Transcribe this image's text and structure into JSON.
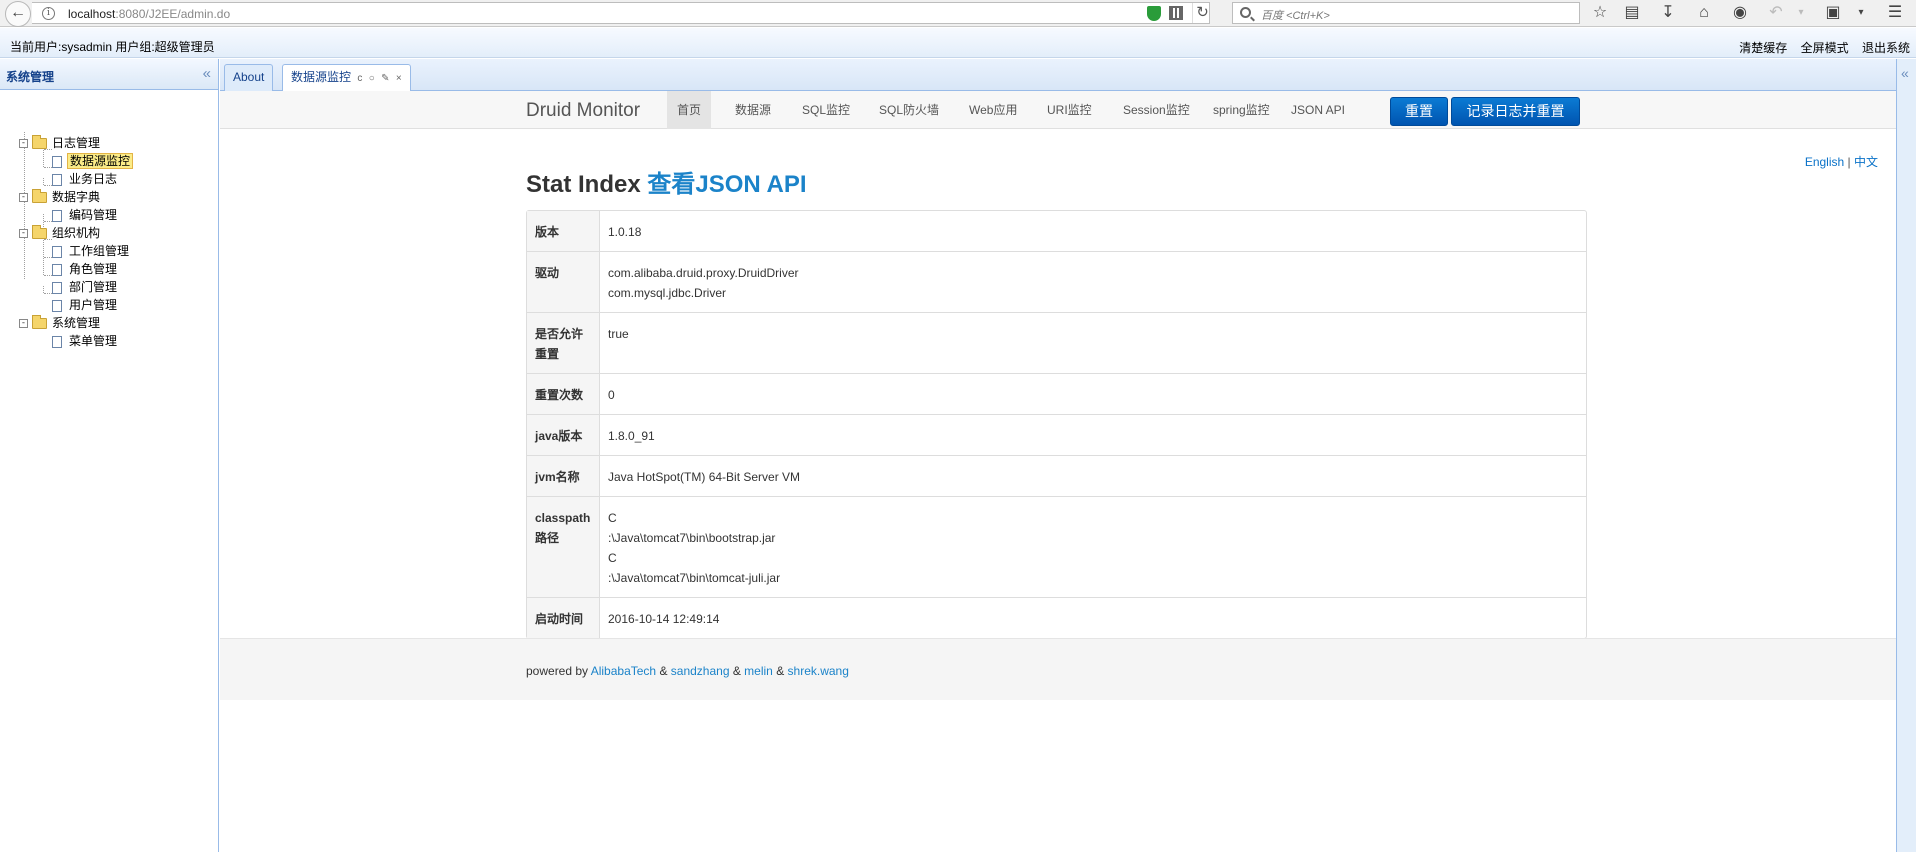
{
  "browser": {
    "url_host": "localhost",
    "url_rest": ":8080/J2EE/admin.do",
    "search_placeholder": "百度 <Ctrl+K>"
  },
  "header": {
    "user_info": "当前用户:sysadmin 用户组:超级管理员",
    "links": [
      "清楚缓存",
      "全屏模式",
      "退出系统"
    ]
  },
  "sidebar": {
    "title": "系统管理",
    "tree": [
      {
        "label": "日志管理",
        "type": "folder"
      },
      {
        "label": "数据源监控",
        "type": "page",
        "selected": true
      },
      {
        "label": "业务日志",
        "type": "page"
      },
      {
        "label": "数据字典",
        "type": "folder"
      },
      {
        "label": "编码管理",
        "type": "page"
      },
      {
        "label": "组织机构",
        "type": "folder"
      },
      {
        "label": "工作组管理",
        "type": "page"
      },
      {
        "label": "角色管理",
        "type": "page"
      },
      {
        "label": "部门管理",
        "type": "page"
      },
      {
        "label": "用户管理",
        "type": "page"
      },
      {
        "label": "系统管理",
        "type": "folder"
      },
      {
        "label": "菜单管理",
        "type": "page"
      }
    ]
  },
  "tabs": [
    {
      "label": "About",
      "active": false
    },
    {
      "label": "数据源监控",
      "active": true
    }
  ],
  "druid": {
    "brand": "Druid Monitor",
    "nav": [
      "首页",
      "数据源",
      "SQL监控",
      "SQL防火墙",
      "Web应用",
      "URI监控",
      "Session监控",
      "spring监控",
      "JSON API"
    ],
    "buttons": [
      "重置",
      "记录日志并重置"
    ],
    "lang_en": "English",
    "lang_sep": " | ",
    "lang_zh": "中文",
    "title_prefix": "Stat Index ",
    "title_link": "查看JSON API",
    "stats": [
      {
        "key": "版本",
        "value": [
          "1.0.18"
        ]
      },
      {
        "key": "驱动",
        "value": [
          "com.alibaba.druid.proxy.DruidDriver",
          "com.mysql.jdbc.Driver"
        ]
      },
      {
        "key": "是否允许重置",
        "value": [
          "true"
        ]
      },
      {
        "key": "重置次数",
        "value": [
          "0"
        ]
      },
      {
        "key": "java版本",
        "value": [
          "1.8.0_91"
        ]
      },
      {
        "key": "jvm名称",
        "value": [
          "Java HotSpot(TM) 64-Bit Server VM"
        ]
      },
      {
        "key": "classpath路径",
        "value": [
          "C",
          ":\\Java\\tomcat7\\bin\\bootstrap.jar",
          "C",
          ":\\Java\\tomcat7\\bin\\tomcat-juli.jar"
        ]
      },
      {
        "key": "启动时间",
        "value": [
          "2016-10-14 12:49:14"
        ]
      }
    ],
    "footer": {
      "prefix": "powered by ",
      "links": [
        "AlibabaTech",
        "sandzhang",
        "melin",
        "shrek.wang"
      ],
      "sep": " & "
    }
  },
  "colors": {
    "accent_blue": "#1b83c9",
    "button_blue": "#0b6fce",
    "panel_border": "#99bbe8",
    "selected_node": "#fbec88"
  }
}
